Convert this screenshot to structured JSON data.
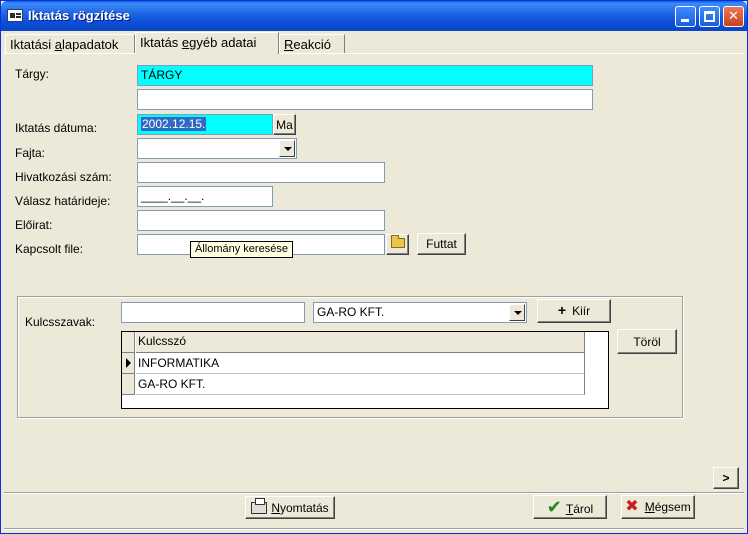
{
  "window": {
    "title": "Iktatás rögzítése"
  },
  "tabs": [
    {
      "pre": "Iktatási ",
      "ul": "a",
      "post": "lapadatok"
    },
    {
      "pre": "Iktatás ",
      "ul": "e",
      "post": "gyéb adatai"
    },
    {
      "pre": "",
      "ul": "R",
      "post": "eakció"
    }
  ],
  "form": {
    "targy_label": "Tárgy:",
    "targy_value": "TÁRGY",
    "targy2_value": "",
    "datum_label": "Iktatás dátuma:",
    "datum_value": "2002.12.15.",
    "ma_button": "Ma",
    "fajta_label": "Fajta:",
    "fajta_value": "",
    "hivatkozasi_label": "Hivatkozási szám:",
    "hivatkozasi_value": "",
    "valasz_label": "Válasz határideje:",
    "valasz_value": "____.__.__.",
    "eloirat_label": "Előirat:",
    "eloirat_value": "",
    "kapcsolt_label": "Kapcsolt file:",
    "kapcsolt_value": "",
    "tooltip": "Állomány keresése",
    "futtat_button": "Futtat"
  },
  "keywords": {
    "label": "Kulcsszavak:",
    "input_value": "",
    "combo_value": "GA-RO KFT.",
    "kiir_button": "Kiír",
    "torol_button": "Töröl",
    "column_header": "Kulcsszó",
    "rows": [
      "INFORMATIKA",
      "GA-RO KFT."
    ]
  },
  "footer": {
    "next_button": ">",
    "print_ul": "N",
    "print_rest": "yomtatás",
    "save_ul": "T",
    "save_rest": "árol",
    "cancel_ul": "M",
    "cancel_rest": "égsem"
  }
}
